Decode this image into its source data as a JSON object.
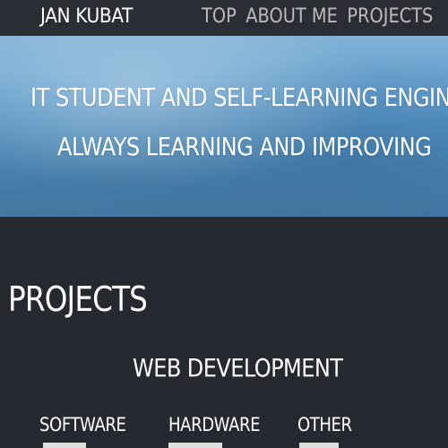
{
  "header": {
    "brand": "JAN KUBAT",
    "nav": [
      "TOP",
      "ABOUT ME",
      "PROJECTS"
    ]
  },
  "hero": {
    "line1": "IT STUDENT AND SELF-LEARNING ENGINEER",
    "line2": "ALWAYS LEARNING AND IMPROVING"
  },
  "projects": {
    "title": "PROJECTS",
    "section": "WEB DEVELOPMENT",
    "categories": [
      "SOFTWARE",
      "HARDWARE",
      "OTHER"
    ]
  },
  "colors": {
    "background": "#262a30",
    "topbar": "#2a2d33",
    "nav_text": "#bcbcbc",
    "sky": "#5e9ccc"
  }
}
